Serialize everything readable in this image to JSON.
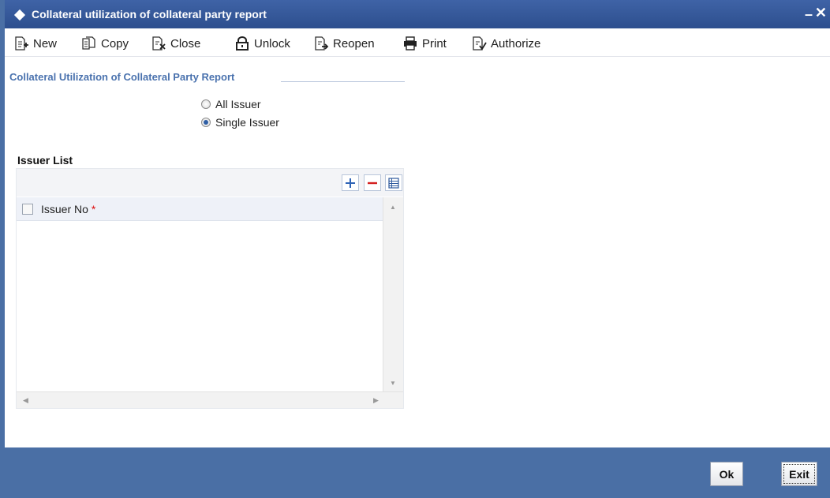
{
  "window": {
    "title": "Collateral utilization of collateral party report",
    "minimize_label": "–",
    "close_label": "✕"
  },
  "toolbar": {
    "new_label": "New",
    "copy_label": "Copy",
    "close_label": "Close",
    "unlock_label": "Unlock",
    "reopen_label": "Reopen",
    "print_label": "Print",
    "authorize_label": "Authorize"
  },
  "section": {
    "title": "Collateral Utilization of Collateral Party Report"
  },
  "issuer_option": {
    "all_label": "All Issuer",
    "single_label": "Single Issuer",
    "selected": "Single Issuer"
  },
  "issuer_list": {
    "title": "Issuer List",
    "columns": [
      "Issuer No"
    ],
    "required_marker": "*"
  },
  "footer": {
    "ok_label": "Ok",
    "exit_label": "Exit"
  },
  "colors": {
    "titlebar": "#2d4f8e",
    "footer": "#4a6fa5",
    "section_title": "#4a72ae"
  }
}
